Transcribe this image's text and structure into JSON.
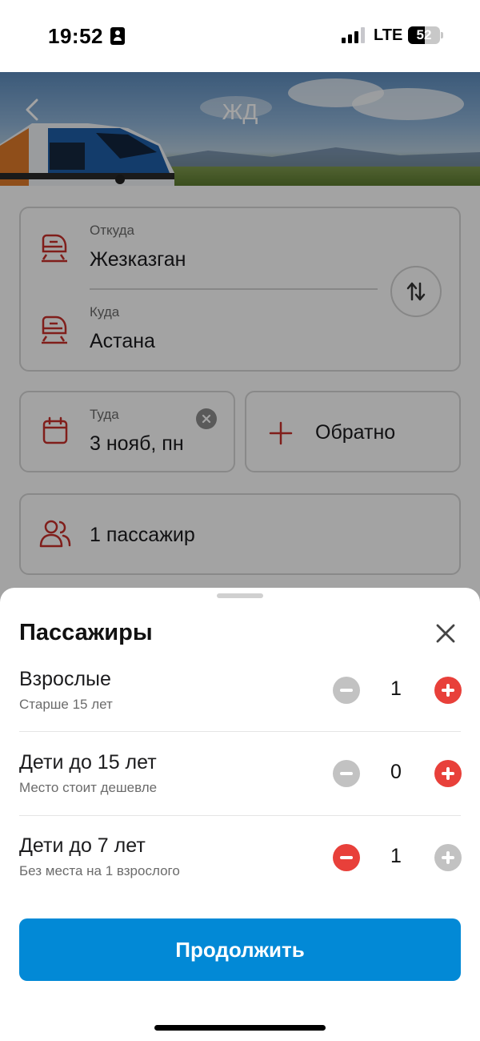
{
  "status_bar": {
    "time": "19:52",
    "network": "LTE",
    "battery_level": "52",
    "battery_fraction": 0.52,
    "signal_bars_active": 3,
    "signal_bars_total": 4
  },
  "header": {
    "title": "ЖД",
    "back_icon": "chevron-left-icon"
  },
  "route": {
    "from_label": "Откуда",
    "from_value": "Жезказган",
    "to_label": "Куда",
    "to_value": "Астана",
    "station_icon": "train-icon",
    "swap_icon": "swap-vertical-icon"
  },
  "dates": {
    "there_label": "Туда",
    "there_value": "3 нояб, пн",
    "return_label": "Обратно",
    "calendar_icon": "calendar-icon",
    "clear_icon": "clear-icon",
    "add_icon": "plus-icon"
  },
  "passengers_field": {
    "value": "1 пассажир",
    "icon": "people-icon"
  },
  "sheet": {
    "title": "Пассажиры",
    "close_icon": "close-icon",
    "rows": [
      {
        "title": "Взрослые",
        "subtitle": "Старше 15 лет",
        "count": "1",
        "minus_enabled": false,
        "plus_enabled": true
      },
      {
        "title": "Дети до 15 лет",
        "subtitle": "Место стоит дешевле",
        "count": "0",
        "minus_enabled": false,
        "plus_enabled": true
      },
      {
        "title": "Дети до 7 лет",
        "subtitle": "Без места на 1 взрослого",
        "count": "1",
        "minus_enabled": true,
        "plus_enabled": false
      }
    ],
    "continue_label": "Продолжить"
  },
  "colors": {
    "accent_red": "#e8403a",
    "disabled_gray": "#c2c2c2",
    "primary_blue": "#0289d6",
    "icon_red": "#c8302b"
  }
}
